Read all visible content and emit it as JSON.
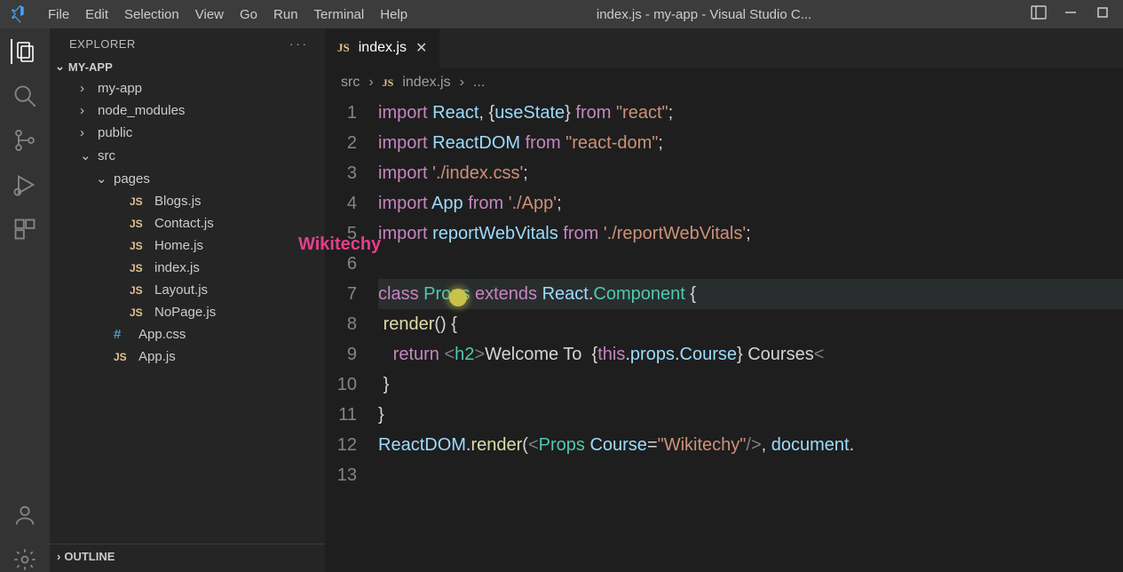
{
  "menu": {
    "items": [
      "File",
      "Edit",
      "Selection",
      "View",
      "Go",
      "Run",
      "Terminal",
      "Help"
    ]
  },
  "title": "index.js - my-app - Visual Studio C...",
  "explorer": {
    "title": "EXPLORER",
    "project": "MY-APP",
    "rows": [
      {
        "depth": 1,
        "chev": "›",
        "kind": "folder",
        "label": "my-app"
      },
      {
        "depth": 1,
        "chev": "›",
        "kind": "folder",
        "label": "node_modules"
      },
      {
        "depth": 1,
        "chev": "›",
        "kind": "folder",
        "label": "public"
      },
      {
        "depth": 1,
        "chev": "⌄",
        "kind": "folder",
        "label": "src"
      },
      {
        "depth": 2,
        "chev": "⌄",
        "kind": "folder",
        "label": "pages"
      },
      {
        "depth": 3,
        "chev": "",
        "kind": "js",
        "label": "Blogs.js"
      },
      {
        "depth": 3,
        "chev": "",
        "kind": "js",
        "label": "Contact.js"
      },
      {
        "depth": 3,
        "chev": "",
        "kind": "js",
        "label": "Home.js"
      },
      {
        "depth": 3,
        "chev": "",
        "kind": "js",
        "label": "index.js"
      },
      {
        "depth": 3,
        "chev": "",
        "kind": "js",
        "label": "Layout.js"
      },
      {
        "depth": 3,
        "chev": "",
        "kind": "js",
        "label": "NoPage.js"
      },
      {
        "depth": 2,
        "chev": "",
        "kind": "css",
        "label": "App.css"
      },
      {
        "depth": 2,
        "chev": "",
        "kind": "js",
        "label": "App.js"
      }
    ],
    "outline": "OUTLINE"
  },
  "watermark": "Wikitechy",
  "tab": {
    "icon": "JS",
    "name": "index.js"
  },
  "breadcrumb": {
    "folder": "src",
    "icon": "JS",
    "file": "index.js",
    "tail": "..."
  },
  "code": {
    "lines": [
      {
        "n": 1,
        "html": "<span class='tok-kw'>import</span> <span class='tok-var'>React</span><span class='tok-punc'>, {</span><span class='tok-var'>useState</span><span class='tok-punc'>}</span> <span class='tok-kw'>from</span> <span class='tok-str'>\"react\"</span><span class='tok-punc'>;</span>"
      },
      {
        "n": 2,
        "html": "<span class='tok-kw'>import</span> <span class='tok-var'>ReactDOM</span> <span class='tok-kw'>from</span> <span class='tok-str'>\"react-dom\"</span><span class='tok-punc'>;</span>"
      },
      {
        "n": 3,
        "html": "<span class='tok-kw'>import</span> <span class='tok-str'>'./index.css'</span><span class='tok-punc'>;</span>"
      },
      {
        "n": 4,
        "html": "<span class='tok-kw'>import</span> <span class='tok-var'>App</span> <span class='tok-kw'>from</span> <span class='tok-str'>'./App'</span><span class='tok-punc'>;</span>"
      },
      {
        "n": 5,
        "html": "<span class='tok-kw'>import</span> <span class='tok-var'>reportWebVitals</span> <span class='tok-kw'>from</span> <span class='tok-str'>'./reportWebVitals'</span><span class='tok-punc'>;</span>"
      },
      {
        "n": 6,
        "html": ""
      },
      {
        "n": 7,
        "hl": true,
        "html": "<span class='tok-kw'>class</span> <span class='tok-type'>Props</span> <span class='tok-kw'>extends</span> <span class='tok-var'>React</span><span class='tok-punc'>.</span><span class='tok-type'>Component</span> <span class='tok-punc'>{</span>"
      },
      {
        "n": 8,
        "html": " <span class='tok-fn'>render</span><span class='tok-punc'>() {</span>"
      },
      {
        "n": 9,
        "html": "   <span class='tok-kw'>return</span> <span class='tok-tag'>&lt;</span><span class='tok-name'>h2</span><span class='tok-tag'>&gt;</span><span class='tok-punc'>Welcome To  </span><span class='tok-punc'>{</span><span class='tok-kw'>this</span><span class='tok-punc'>.</span><span class='tok-var'>props</span><span class='tok-punc'>.</span><span class='tok-var'>Course</span><span class='tok-punc'>}</span><span class='tok-punc'> Courses</span><span class='tok-tag'>&lt;</span>"
      },
      {
        "n": 10,
        "html": " <span class='tok-punc'>}</span>"
      },
      {
        "n": 11,
        "html": "<span class='tok-punc'>}</span>"
      },
      {
        "n": 12,
        "html": "<span class='tok-var'>ReactDOM</span><span class='tok-punc'>.</span><span class='tok-fn'>render</span><span class='tok-punc'>(</span><span class='tok-tag'>&lt;</span><span class='tok-name'>Props</span> <span class='tok-attr'>Course</span><span class='tok-punc'>=</span><span class='tok-str'>\"Wikitechy\"</span><span class='tok-tag'>/&gt;</span><span class='tok-punc'>, </span><span class='tok-var'>document</span><span class='tok-punc'>.</span>"
      },
      {
        "n": 13,
        "html": ""
      }
    ]
  }
}
